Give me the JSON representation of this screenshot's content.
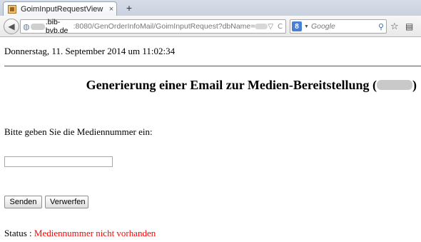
{
  "browser": {
    "tab_title": "GoimInputRequestView",
    "tab_close": "×",
    "new_tab": "+",
    "url_host": ".bib-bvb.de",
    "url_path": ":8080/GenOrderInfoMail/GoimInputRequest?dbName=",
    "search_engine_letter": "8",
    "search_placeholder": "Google",
    "icons": {
      "back": "arrow-left-icon",
      "site": "globe-icon",
      "dropdown": "chevron-down-icon",
      "reload": "reload-icon",
      "search": "magnifier-icon",
      "bookmark": "star-icon",
      "clipboard": "clipboard-icon"
    }
  },
  "page": {
    "date": "Donnerstag, 11. September 2014 um 11:02:34",
    "heading_prefix": "Generierung einer Email zur Medien-Bereitstellung (",
    "heading_suffix": ")",
    "prompt": "Bitte geben Sie die Mediennummer ein:",
    "input_value": "",
    "send_label": "Senden",
    "reject_label": "Verwerfen",
    "status_label": "Status : ",
    "status_message": "Mediennummer nicht vorhanden",
    "status_color": "#ff0000"
  }
}
